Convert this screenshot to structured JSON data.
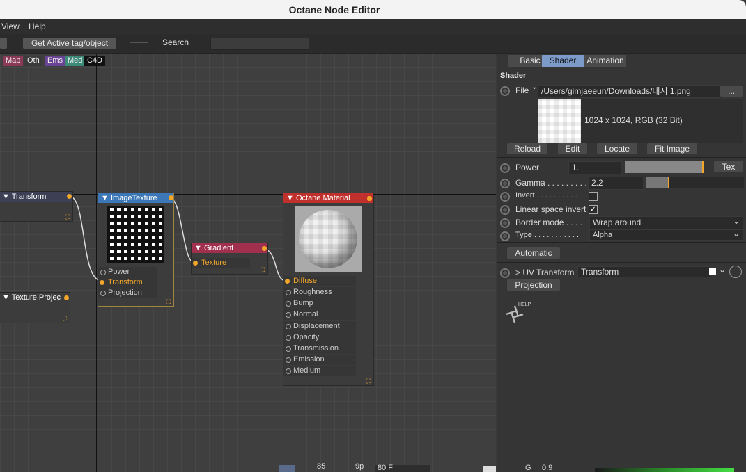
{
  "window": {
    "title": "Octane Node Editor"
  },
  "menu": {
    "view": "View",
    "help": "Help"
  },
  "toolbar": {
    "get_active": "Get Active tag/object",
    "search_label": "Search",
    "search_value": ""
  },
  "categories": [
    {
      "label": "Map",
      "color": "#8a3a56"
    },
    {
      "label": "Oth",
      "color": "#3b3b3b"
    },
    {
      "label": "Ems",
      "color": "#6a4494"
    },
    {
      "label": "Med",
      "color": "#3e8a78"
    },
    {
      "label": "C4D",
      "color": "#111111"
    }
  ],
  "nodes": {
    "transform": {
      "title": "Transform"
    },
    "texture_proj": {
      "title": "Texture Projec"
    },
    "image_texture": {
      "title": "ImageTexture",
      "pins": [
        "Power",
        "Transform",
        "Projection"
      ]
    },
    "gradient": {
      "title": "Gradient",
      "pins": [
        "Texture"
      ]
    },
    "material": {
      "title": "Octane Material",
      "pins": [
        "Diffuse",
        "Roughness",
        "Bump",
        "Normal",
        "Displacement",
        "Opacity",
        "Transmission",
        "Emission",
        "Medium"
      ]
    }
  },
  "panel": {
    "tabs": [
      "Basic",
      "Shader",
      "Animation"
    ],
    "section": "Shader",
    "file_label": "File",
    "file_path": "/Users/gimjaeeun/Downloads/대지 1.png",
    "file_browse": "...",
    "image_info": "1024 x 1024, RGB (32 Bit)",
    "buttons": [
      "Reload",
      "Edit",
      "Locate",
      "Fit Image"
    ],
    "power_label": "Power",
    "power_value": "1.",
    "power_level": 0.98,
    "tex_button": "Tex",
    "gamma_label": "Gamma . . . . . . . . .",
    "gamma_value": "2.2",
    "gamma_level": 0.22,
    "invert_label": "Invert . . . . . . . . . .",
    "linear_label": "Linear space invert",
    "border_label": "Border mode . . . .",
    "border_value": "Wrap around",
    "type_label": "Type . . . . . . . . . . .",
    "type_value": "Alpha",
    "automatic": "Automatic",
    "uv_label": "> UV Transform",
    "uv_value": "Transform",
    "projection": "Projection",
    "help": "HELP"
  },
  "bottom": {
    "v1": "85",
    "v2": "9p",
    "v3": "80 F",
    "g_label": "G",
    "g_value": "0.9"
  }
}
